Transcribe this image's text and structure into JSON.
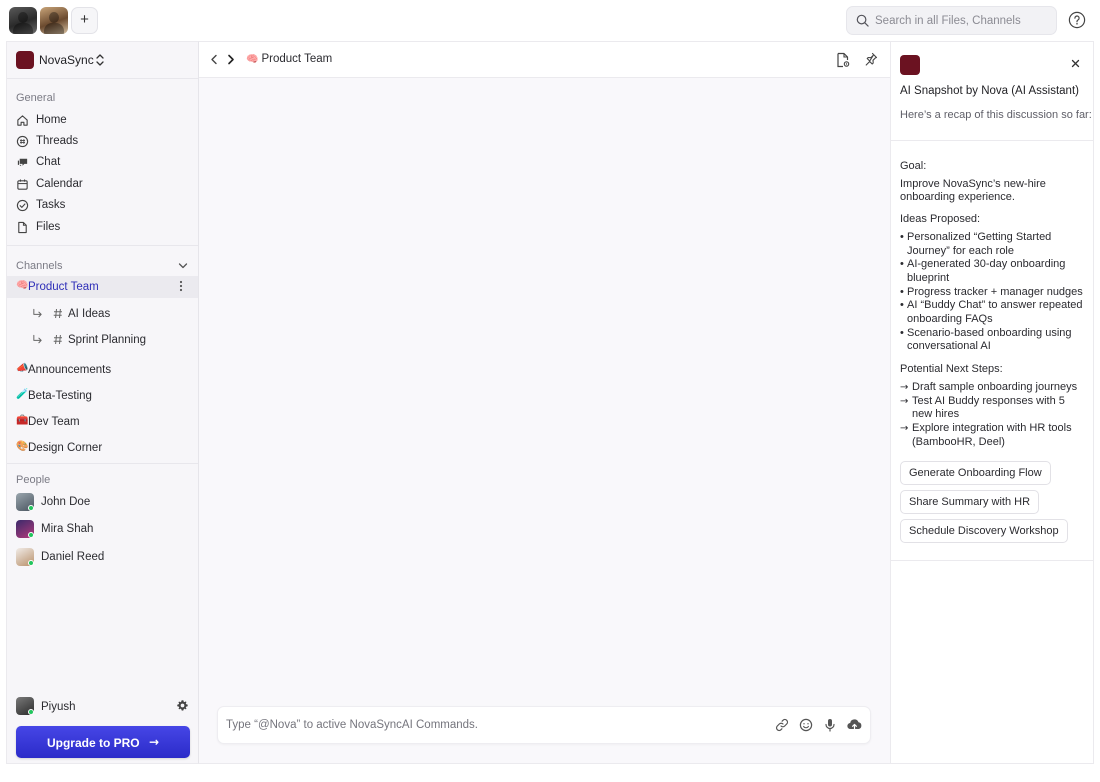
{
  "topbar": {
    "add_label": "+",
    "search_placeholder": "Search in all Files, Channels"
  },
  "org": {
    "name": "NovaSync",
    "color": "#6b1221"
  },
  "sidebar": {
    "general_label": "General",
    "general_items": [
      {
        "label": "Home",
        "icon": "home-icon"
      },
      {
        "label": "Threads",
        "icon": "threads-icon"
      },
      {
        "label": "Chat",
        "icon": "chat-icon"
      },
      {
        "label": "Calendar",
        "icon": "calendar-icon"
      },
      {
        "label": "Tasks",
        "icon": "tasks-icon"
      },
      {
        "label": "Files",
        "icon": "file-icon"
      }
    ],
    "channels_label": "Channels",
    "channels": [
      {
        "emoji": "🧠",
        "label": "Product Team",
        "active": true
      },
      {
        "emoji": "📣",
        "label": "Announcements"
      },
      {
        "emoji": "🧪",
        "label": "Beta-Testing"
      },
      {
        "emoji": "🧰",
        "label": "Dev Team"
      },
      {
        "emoji": "🎨",
        "label": "Design Corner"
      }
    ],
    "sub_channels": [
      {
        "label": "AI Ideas"
      },
      {
        "label": "Sprint Planning"
      }
    ],
    "people_label": "People",
    "people": [
      {
        "name": "John Doe",
        "status": "online"
      },
      {
        "name": "Mira Shah",
        "status": "online"
      },
      {
        "name": "Daniel Reed",
        "status": "online"
      }
    ],
    "me": {
      "name": "Piyush",
      "status": "online"
    },
    "upgrade_label": "Upgrade to PRO",
    "upgrade_arrow": "→"
  },
  "main": {
    "breadcrumb_emoji": "🧠",
    "breadcrumb_label": "Product Team",
    "composer_placeholder": "Type “@Nova” to active NovaSyncAI Commands."
  },
  "assistant": {
    "title": "AI Snapshot by Nova (AI Assistant)",
    "subtitle": "Here’s a recap of this discussion so far:",
    "goal_label": "Goal:",
    "goal_text": "Improve NovaSync’s new-hire onboarding experience.",
    "ideas_label": "Ideas Proposed:",
    "ideas": [
      "Personalized “Getting Started Journey” for each role",
      "AI-generated 30-day onboarding blueprint",
      "Progress tracker + manager nudges",
      "AI “Buddy Chat” to answer repeated onboarding FAQs",
      "Scenario-based onboarding using conversational AI"
    ],
    "next_label": "Potential Next Steps:",
    "next_steps": [
      "Draft sample onboarding journeys",
      "Test AI Buddy responses with 5 new hires",
      "Explore integration with HR tools (BambooHR, Deel)"
    ],
    "actions": [
      "Generate Onboarding Flow",
      "Share Summary with HR",
      "Schedule Discovery Workshop"
    ],
    "close_label": "×"
  },
  "colors": {
    "accent": "#2f2fb8",
    "upgrade": "#3a3ad8",
    "online": "#22c55e",
    "brand": "#6b1221"
  }
}
